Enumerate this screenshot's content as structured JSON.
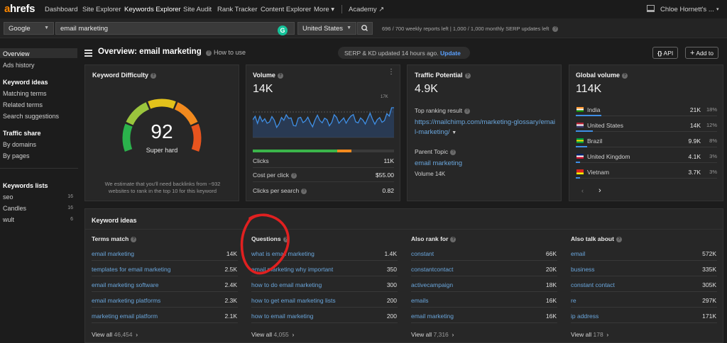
{
  "nav": {
    "logo_a": "a",
    "logo_rest": "hrefs",
    "links": [
      "Dashboard",
      "Site Explorer",
      "Keywords Explorer",
      "Site Audit",
      "Rank Tracker",
      "Content Explorer",
      "More",
      "Academy"
    ],
    "user": "Chloe Hornett's ..."
  },
  "search": {
    "engine": "Google",
    "keyword": "email marketing",
    "country": "United States",
    "quota": "696 / 700 weekly reports left  |  1,000 / 1,000 monthly SERP updates left"
  },
  "sidebar": {
    "overview": "Overview",
    "ads_history": "Ads history",
    "ideas_head": "Keyword ideas",
    "matching": "Matching terms",
    "related": "Related terms",
    "suggestions": "Search suggestions",
    "traffic_head": "Traffic share",
    "by_domains": "By domains",
    "by_pages": "By pages",
    "lists_head": "Keywords lists",
    "lists": [
      {
        "name": "seo",
        "count": "16"
      },
      {
        "name": "Candles",
        "count": "16"
      },
      {
        "name": "wult",
        "count": "6"
      }
    ]
  },
  "header": {
    "title": "Overview: email marketing",
    "howto": "How to use",
    "serp_text": "SERP & KD updated 14 hours ago.",
    "serp_update": "Update",
    "api": "API",
    "add_to": "Add to"
  },
  "kd": {
    "title": "Keyword Difficulty",
    "value": 92,
    "label": "Super hard",
    "note": "We estimate that you'll need backlinks from ~932 websites to rank in the top 10 for this keyword"
  },
  "volume": {
    "title": "Volume",
    "value": "14K",
    "chart_max": "17K",
    "rows": [
      {
        "label": "Clicks",
        "value": "11K"
      },
      {
        "label": "Cost per click",
        "value": "$55.00"
      },
      {
        "label": "Clicks per search",
        "value": "0.82"
      }
    ]
  },
  "traffic": {
    "title": "Traffic Potential",
    "value": "4.9K",
    "top_label": "Top ranking result",
    "top_url": "https://mailchimp.com/marketing-glossary/email-marketing/",
    "parent_label": "Parent Topic",
    "parent_kw": "email marketing",
    "parent_vol": "Volume 14K"
  },
  "global": {
    "title": "Global volume",
    "value": "114K",
    "countries": [
      {
        "name": "India",
        "vol": "21K",
        "pct": "18%",
        "share": 0.18
      },
      {
        "name": "United States",
        "vol": "14K",
        "pct": "12%",
        "share": 0.12
      },
      {
        "name": "Brazil",
        "vol": "9.9K",
        "pct": "8%",
        "share": 0.08
      },
      {
        "name": "United Kingdom",
        "vol": "4.1K",
        "pct": "3%",
        "share": 0.03
      },
      {
        "name": "Vietnam",
        "vol": "3.7K",
        "pct": "3%",
        "share": 0.03
      }
    ]
  },
  "ideas": {
    "title": "Keyword ideas",
    "columns": [
      {
        "head": "Terms match",
        "rows": [
          [
            "email marketing",
            "14K"
          ],
          [
            "templates for email marketing",
            "2.5K"
          ],
          [
            "email marketing software",
            "2.4K"
          ],
          [
            "email marketing platforms",
            "2.3K"
          ],
          [
            "marketing email platform",
            "2.1K"
          ]
        ],
        "view": "View all",
        "count": "46,454"
      },
      {
        "head": "Questions",
        "rows": [
          [
            "what is email marketing",
            "1.4K"
          ],
          [
            "email marketing why important",
            "350"
          ],
          [
            "how to do email marketing",
            "300"
          ],
          [
            "how to get email marketing lists",
            "200"
          ],
          [
            "how to email marketing",
            "200"
          ]
        ],
        "view": "View all",
        "count": "4,055"
      },
      {
        "head": "Also rank for",
        "rows": [
          [
            "constant",
            "66K"
          ],
          [
            "constantcontact",
            "20K"
          ],
          [
            "activecampaign",
            "18K"
          ],
          [
            "emails",
            "16K"
          ],
          [
            "email marketing",
            "16K"
          ]
        ],
        "view": "View all",
        "count": "7,316"
      },
      {
        "head": "Also talk about",
        "rows": [
          [
            "email",
            "572K"
          ],
          [
            "business",
            "335K"
          ],
          [
            "constant contact",
            "305K"
          ],
          [
            "re",
            "297K"
          ],
          [
            "ip address",
            "171K"
          ]
        ],
        "view": "View all",
        "count": "178"
      }
    ]
  }
}
